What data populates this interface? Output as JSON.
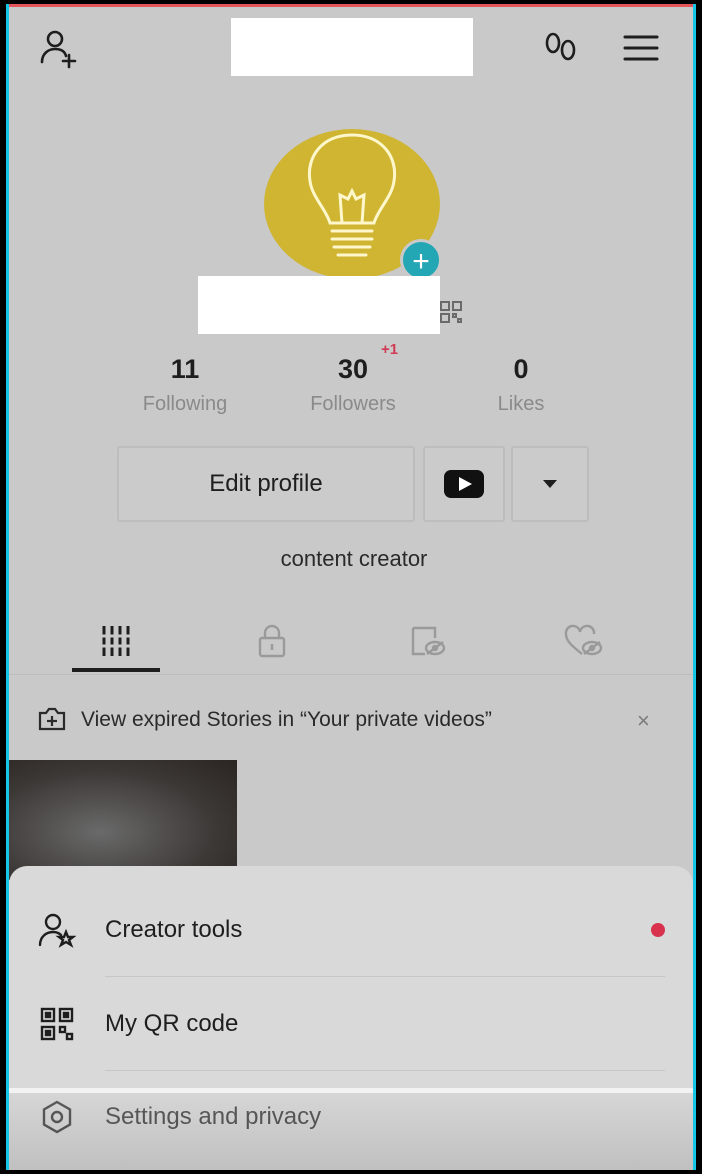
{
  "header": {
    "add_friend_icon": "add-user-icon",
    "footprint_icon": "footprints-icon",
    "menu_icon": "hamburger-menu-icon"
  },
  "profile": {
    "avatar_icon": "lightbulb-icon",
    "stats": [
      {
        "value": "11",
        "label": "Following"
      },
      {
        "value": "30",
        "label": "Followers"
      },
      {
        "value": "0",
        "label": "Likes"
      }
    ],
    "followers_badge": "+1",
    "edit_profile_label": "Edit profile",
    "bio": "content creator"
  },
  "tabs": [
    "videos-grid-icon",
    "private-lock-icon",
    "reposts-icon",
    "liked-icon"
  ],
  "notice": {
    "text": "View expired Stories in “Your private videos”",
    "close": "×"
  },
  "sheet": {
    "items": [
      {
        "label": "Creator tools",
        "icon": "creator-tools-icon",
        "has_dot": true
      },
      {
        "label": "My QR code",
        "icon": "qr-code-icon"
      },
      {
        "label": "Settings and privacy",
        "icon": "settings-gear-icon"
      }
    ]
  },
  "colors": {
    "avatar_bg": "#cfb532",
    "plus_badge": "#23a7b4",
    "notification_dot": "#d8324f",
    "frame_accent": "#16c6e6"
  }
}
